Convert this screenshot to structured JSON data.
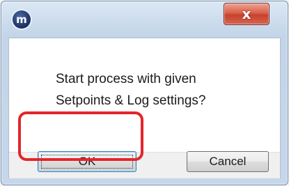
{
  "window": {
    "app_icon": {
      "icon": "app-logo-icon",
      "glyph": "m"
    },
    "close_button": {
      "icon": "close-icon",
      "glyph": "x"
    }
  },
  "dialog": {
    "message_lines": [
      "Start process with given",
      "Setpoints & Log settings?"
    ],
    "ok_label": "OK",
    "cancel_label": "Cancel"
  },
  "colors": {
    "highlight": "#e3262b",
    "close_button": "#c7412d"
  }
}
